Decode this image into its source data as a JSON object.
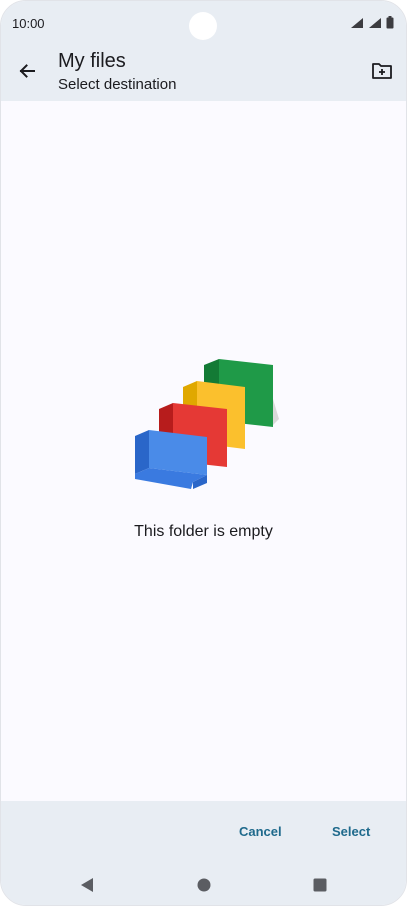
{
  "status_bar": {
    "time": "10:00",
    "icons": [
      "wifi-icon",
      "signal-icon",
      "battery-icon"
    ]
  },
  "app_bar": {
    "title": "My files",
    "subtitle": "Select destination",
    "back_icon": "arrow-back-icon",
    "action_icon": "create-new-folder-icon"
  },
  "content": {
    "empty_message": "This folder is empty",
    "illustration": "empty-folders-illustration"
  },
  "actions": {
    "cancel_label": "Cancel",
    "select_label": "Select"
  },
  "nav_bar": {
    "icons": [
      "nav-back-icon",
      "nav-home-icon",
      "nav-recents-icon"
    ]
  },
  "colors": {
    "accent": "#1f6a8c",
    "bar_background": "#e8edf3",
    "surface": "#fbfaff"
  }
}
